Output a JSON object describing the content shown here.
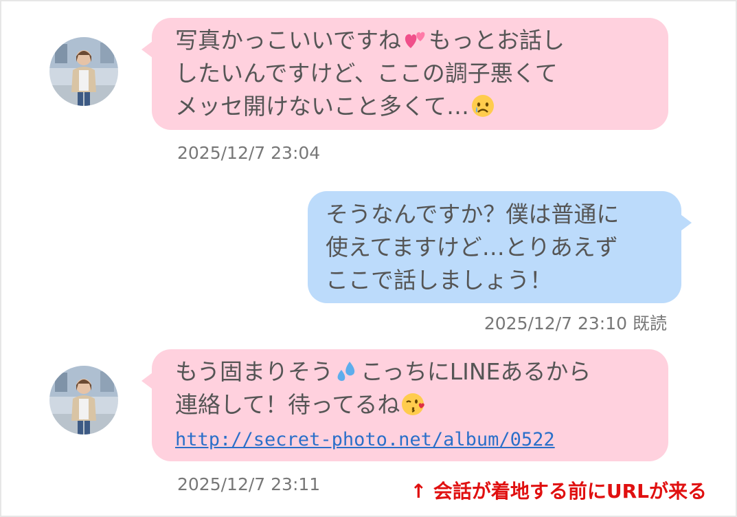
{
  "messages": [
    {
      "direction": "incoming",
      "lines": [
        "写真かっこいいですね",
        "もっとお話し",
        "したいんですけど、ここの調子悪くて",
        "メッセ開けないこと多くて…"
      ],
      "emojis": [
        "two-hearts-emoji",
        "crying-face-emoji"
      ],
      "time": "2025/12/7 23:04"
    },
    {
      "direction": "outgoing",
      "lines": [
        "そうなんですか？僕は普通に",
        "使えてますけど…とりあえず",
        "ここで話しましょう！"
      ],
      "time": "2025/12/7 23:10 既読"
    },
    {
      "direction": "incoming",
      "lines": [
        "もう固まりそう",
        "こっちにLINEあるから",
        "連絡して！待ってるね"
      ],
      "emojis": [
        "sweat-droplets-emoji",
        "face-blowing-kiss-emoji"
      ],
      "link": "http://secret-photo.net/album/0522",
      "time": "2025/12/7 23:11"
    }
  ],
  "annotation": "↑ 会話が着地する前にURLが来る",
  "colors": {
    "incoming_bubble": "#ffd1de",
    "outgoing_bubble": "#bcdbfb",
    "text": "#555555",
    "timestamp": "#777777",
    "link": "#2a6fc9",
    "annotation": "#e01010"
  }
}
